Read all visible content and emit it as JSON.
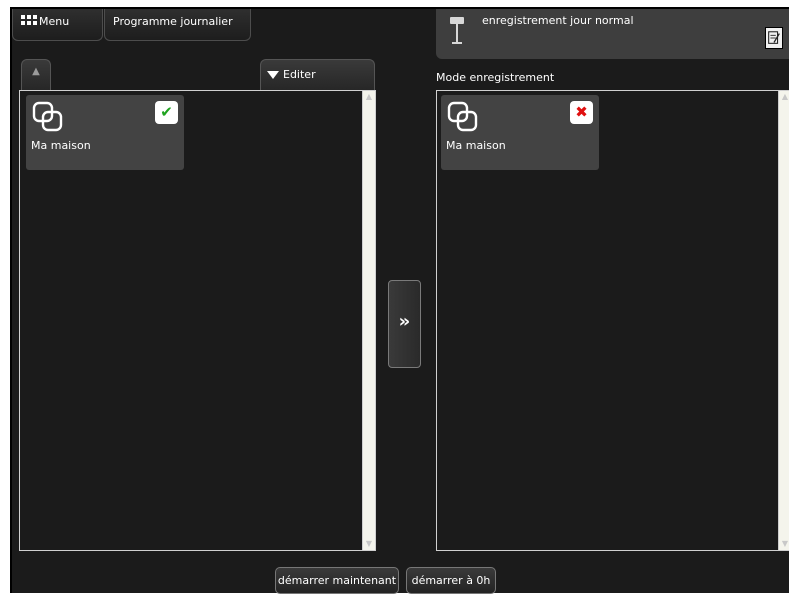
{
  "header": {
    "menu_label": "Menu",
    "program_label": "Programme journalier"
  },
  "record_header": {
    "title": "enregistrement jour normal",
    "record_icon": "recording-lamp-icon",
    "edit_icon": "notepad-edit-icon"
  },
  "left_panel": {
    "up_icon": "chevron-up-icon",
    "edit_label": "Editer",
    "items": [
      {
        "label": "Ma maison",
        "icon": "overlapping-squares-icon",
        "status": "check-icon"
      }
    ]
  },
  "right_panel": {
    "title": "Mode enregistrement",
    "items": [
      {
        "label": "Ma maison",
        "icon": "overlapping-squares-icon",
        "status": "cross-icon"
      }
    ]
  },
  "transfer": {
    "icon": "double-chevron-right-icon",
    "glyph": "»"
  },
  "footer": {
    "start_now_label": "démarrer maintenant",
    "start_0h_label": "démarrer à 0h"
  },
  "colors": {
    "background": "#1b1b1b",
    "tile": "#434343",
    "check": "#1fa31f",
    "cross": "#e01010",
    "panel_border": "#d0d0d0"
  }
}
